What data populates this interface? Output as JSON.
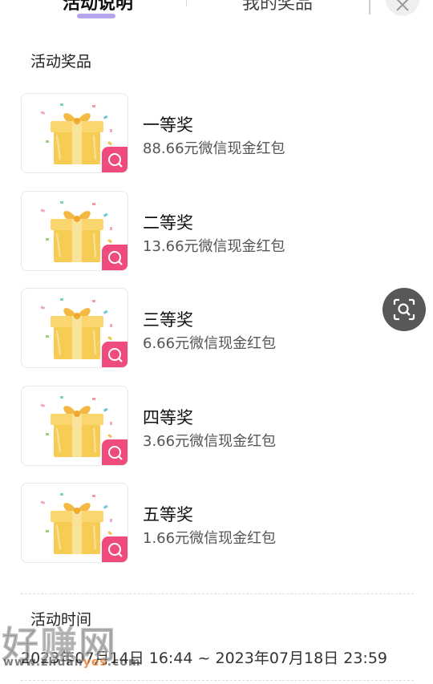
{
  "tabs": {
    "active_label": "活动说明",
    "inactive_label": "我的奖品",
    "indicator_color": "#b7a6ee"
  },
  "close_icon": "close-icon",
  "section_title": "活动奖品",
  "prizes": [
    {
      "name": "一等奖",
      "desc": "88.66元微信现金红包"
    },
    {
      "name": "二等奖",
      "desc": "13.66元微信现金红包"
    },
    {
      "name": "三等奖",
      "desc": "6.66元微信现金红包"
    },
    {
      "name": "四等奖",
      "desc": "3.66元微信现金红包"
    },
    {
      "name": "五等奖",
      "desc": "1.66元微信现金红包"
    }
  ],
  "badge_color": "#ef4b7c",
  "badge_icon": "search-icon",
  "scan_icon": "scan-search-icon",
  "time": {
    "title": "活动时间",
    "value": "2023年07月14日 16:44 ~ 2023年07月18日 23:59"
  },
  "watermark": {
    "big": "好赚网",
    "small_prefix": "www.zhuan",
    "small_highlight": "yes",
    "small_suffix": ".com"
  }
}
